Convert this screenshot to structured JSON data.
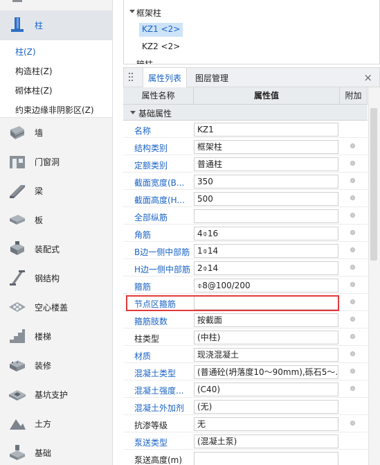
{
  "nav": {
    "items": [
      {
        "label": "柱",
        "icon": "column-icon",
        "active": true
      },
      {
        "label": "墙",
        "icon": "wall-icon"
      },
      {
        "label": "门窗洞",
        "icon": "door-window-icon"
      },
      {
        "label": "梁",
        "icon": "beam-icon"
      },
      {
        "label": "板",
        "icon": "slab-icon"
      },
      {
        "label": "装配式",
        "icon": "prefab-icon"
      },
      {
        "label": "钢结构",
        "icon": "steel-structure-icon"
      },
      {
        "label": "空心楼盖",
        "icon": "hollow-floor-icon"
      },
      {
        "label": "楼梯",
        "icon": "stairs-icon"
      },
      {
        "label": "装修",
        "icon": "decoration-icon"
      },
      {
        "label": "基坑支护",
        "icon": "foundation-pit-icon"
      },
      {
        "label": "土方",
        "icon": "earthwork-icon"
      },
      {
        "label": "基础",
        "icon": "foundation-icon"
      }
    ],
    "sub_items": [
      "柱(Z)",
      "构造柱(Z)",
      "砌体柱(Z)",
      "约束边缘非阴影区(Z)"
    ]
  },
  "tree": {
    "group": "框架柱",
    "items": [
      "KZ1 <2>",
      "KZ2 <2>"
    ],
    "cut_item": "暗柱"
  },
  "panel": {
    "tabs": [
      "属性列表",
      "图层管理"
    ],
    "close": "×"
  },
  "grid": {
    "headers": [
      "属性名称",
      "属性值",
      "附加"
    ],
    "group": "基础属性",
    "rows": [
      {
        "name": "名称",
        "value": "KZ1",
        "blue": true,
        "dot": false
      },
      {
        "name": "结构类别",
        "value": "框架柱",
        "blue": true,
        "dot": true
      },
      {
        "name": "定额类别",
        "value": "普通柱",
        "blue": true,
        "dot": true
      },
      {
        "name": "截面宽度(B...",
        "value": "350",
        "blue": true,
        "dot": true
      },
      {
        "name": "截面高度(H...",
        "value": "500",
        "blue": true,
        "dot": true
      },
      {
        "name": "全部纵筋",
        "value": "",
        "blue": true,
        "dot": true
      },
      {
        "name": "角筋",
        "value": "4⌽16",
        "blue": true,
        "dot": true
      },
      {
        "name": "B边一侧中部筋",
        "value": "1⌽14",
        "blue": true,
        "dot": true
      },
      {
        "name": "H边一侧中部筋",
        "value": "2⌽14",
        "blue": true,
        "dot": true
      },
      {
        "name": "箍筋",
        "value": "⌽8@100/200",
        "blue": true,
        "dot": true
      },
      {
        "name": "节点区箍筋",
        "value": "",
        "blue": true,
        "dot": true
      },
      {
        "name": "箍筋肢数",
        "value": "按截面",
        "blue": true,
        "dot": true
      },
      {
        "name": "柱类型",
        "value": "(中柱)",
        "blue": false,
        "dot": true
      },
      {
        "name": "材质",
        "value": "现浇混凝土",
        "blue": true,
        "dot": true
      },
      {
        "name": "混凝土类型",
        "value": "(普通砼(坍落度10～90mm),砾石5～...",
        "blue": true,
        "dot": true
      },
      {
        "name": "混凝土强度...",
        "value": "(C40)",
        "blue": true,
        "dot": true
      },
      {
        "name": "混凝土外加剂",
        "value": "(无)",
        "blue": true,
        "dot": false
      },
      {
        "name": "抗渗等级",
        "value": "无",
        "blue": false,
        "dot": true
      },
      {
        "name": "泵送类型",
        "value": "(混凝土泵)",
        "blue": true,
        "dot": false
      },
      {
        "name": "泵送高度(m)",
        "value": "",
        "blue": false,
        "dot": false
      }
    ]
  }
}
